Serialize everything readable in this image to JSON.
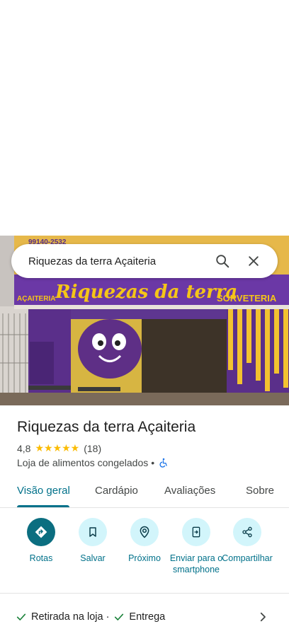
{
  "search": {
    "query": "Riquezas da terra Açaiteria",
    "search_icon": "search-icon",
    "close_icon": "close-icon"
  },
  "photo": {
    "sign_text": "Riquezas da terra",
    "left_label": "AÇAITERIA",
    "right_label": "SORVETERIA",
    "phone_fragment": "99140-2532"
  },
  "place": {
    "name": "Riquezas da terra Açaiteria",
    "rating": "4,8",
    "stars": "★★★★★",
    "review_count": "(18)",
    "category": "Loja de alimentos congelados",
    "category_sep": "•",
    "accessibility_icon": "wheelchair-icon"
  },
  "tabs": [
    {
      "label": "Visão geral"
    },
    {
      "label": "Cardápio"
    },
    {
      "label": "Avaliações"
    },
    {
      "label": "Sobre"
    }
  ],
  "actions": [
    {
      "label": "Rotas",
      "icon": "directions-icon"
    },
    {
      "label": "Salvar",
      "icon": "bookmark-icon"
    },
    {
      "label": "Próximo",
      "icon": "nearby-icon"
    },
    {
      "label": "Enviar para o smartphone",
      "icon": "send-to-phone-icon"
    },
    {
      "label": "Compartilhar",
      "icon": "share-icon"
    }
  ],
  "services": {
    "pickup": "Retirada na loja",
    "sep": "·",
    "delivery": "Entrega"
  },
  "colors": {
    "accent": "#01718a",
    "action_bg": "#d2f5fb",
    "primary_action": "#0b6e80",
    "star": "#fbbc04",
    "check": "#188038"
  }
}
